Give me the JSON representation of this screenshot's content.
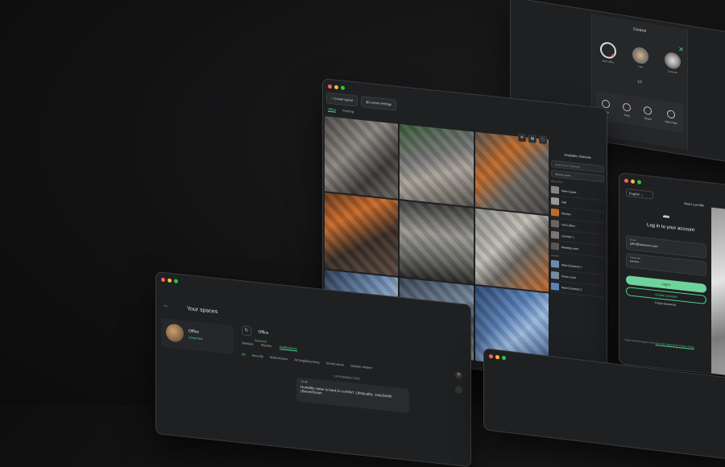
{
  "main_window": {
    "toolbar": {
      "create_layout": "Create layout",
      "layout_settings": "Layout settings"
    },
    "tabs": [
      "Office",
      "Parking"
    ],
    "cameras": [
      "c1",
      "c2",
      "c3",
      "c4",
      "c5",
      "c6",
      "c7",
      "c8",
      "c9"
    ],
    "sidebar": {
      "title": "Available channels",
      "search_placeholder": "Search for channels",
      "select_value": "Dining room",
      "group_1": "Office floor",
      "group_2": "Outside",
      "channels": [
        "Main Space",
        "Hall",
        "Kitchen",
        "CEO office",
        "Corridor 1",
        "Meeting room"
      ],
      "outside_channels": [
        "Main Entrance 1",
        "Smart zone",
        "Main Entrance 2"
      ]
    }
  },
  "controls_window": {
    "title": "Control",
    "rings": [
      {
        "label": "Main office"
      },
      {
        "label": "Hall"
      },
      {
        "label": "Cameras"
      }
    ],
    "pager": "1/2",
    "modes": [
      "Home",
      "Away",
      "Disarm",
      "Night mode"
    ]
  },
  "login_window": {
    "language": "English",
    "need_help": "Need a profile",
    "title": "Log in to your account",
    "email_label": "Email",
    "email_value": "john@amazon.com",
    "password_label": "Password",
    "password_value": "••••••••",
    "login_button": "Log in",
    "create_button": "Create account",
    "forgot": "Forgot password",
    "terms_prefix": "I have read and agree to the",
    "terms_link": "End User Agreement, Privacy Policy"
  },
  "spaces_window": {
    "title": "Your spaces",
    "space_name": "Office",
    "space_status": "Disarmed",
    "header_name": "Office",
    "header_status": "Disarmed",
    "sub_tabs": [
      "Devices",
      "Rooms",
      "Notifications"
    ],
    "filters": [
      "All",
      "Security",
      "Malfunctions",
      "Arming/disarming",
      "Smart Home",
      "System related"
    ],
    "date": "CATERBAMES 2020",
    "notification": {
      "time": "19:49",
      "text": "Humidity value is back to comfort. LifeQuality. JaneSmith (ServerRoom"
    }
  },
  "colors": {
    "accent": "#4fd18b",
    "background": "#121213",
    "window": "#1f2022"
  }
}
